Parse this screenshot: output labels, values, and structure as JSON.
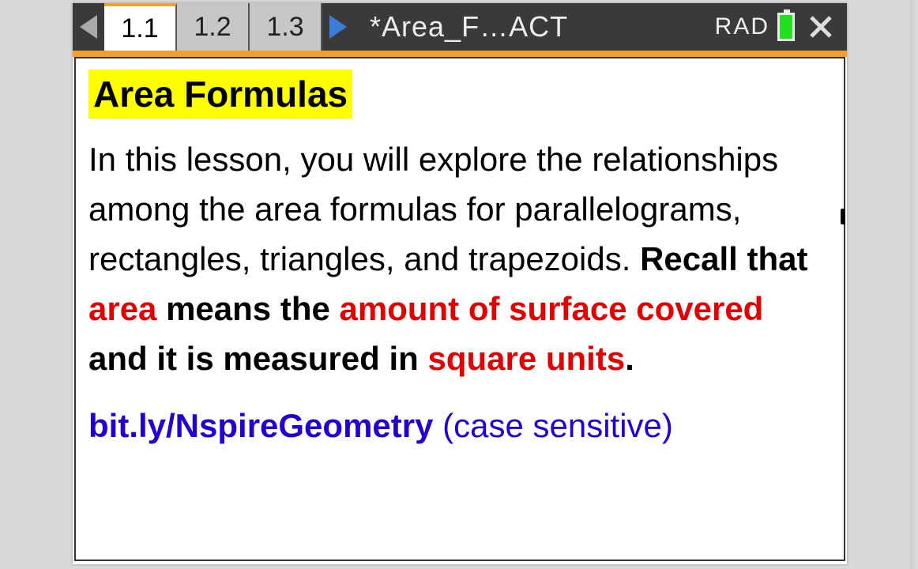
{
  "titlebar": {
    "tabs": [
      "1.1",
      "1.2",
      "1.3"
    ],
    "active_tab_index": 0,
    "doc_title": "*Area_F…ACT",
    "angle_mode": "RAD"
  },
  "content": {
    "heading": "Area Formulas",
    "p1_a": "In this lesson, you will explore the relationships among the area formulas for parallelograms, rectangles, triangles, and trapezoids.  ",
    "p1_b": "Recall that ",
    "p1_c": "area",
    "p1_d": " means the ",
    "p1_e": "amount of surface covered ",
    "p1_f": " and it is measured in ",
    "p1_g": "square units",
    "p1_h": ".",
    "link_url": "bit.ly/NspireGeometry",
    "link_note": "  (case sensitive)"
  }
}
